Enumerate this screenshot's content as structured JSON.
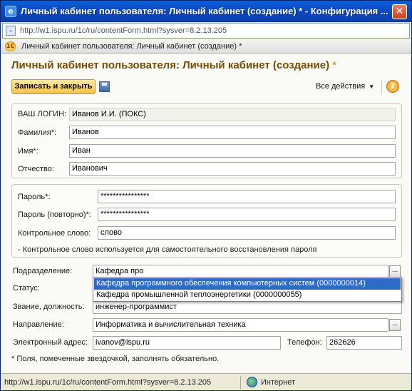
{
  "window": {
    "title": "Личный кабинет пользователя: Личный кабинет (создание) * - Конфигурация ...",
    "close_glyph": "✕"
  },
  "address": {
    "url": "http://w1.ispu.ru/1c/ru/contentForm.html?sysver=8.2.13.205"
  },
  "tab": {
    "label": "Личный кабинет пользователя: Личный кабинет (создание) *",
    "app_icon_text": "1С"
  },
  "form": {
    "title": "Личный кабинет пользователя: Личный кабинет (создание)",
    "modified_mark": "*",
    "save_close_label": "Записать и закрыть",
    "all_actions_label": "Все действия",
    "help_glyph": "?"
  },
  "personal": {
    "login_label": "ВАШ ЛОГИН:",
    "login_value": "Иванов И.И. (ПОКС)",
    "lastname_label": "Фамилия*:",
    "lastname_value": "Иванов",
    "firstname_label": "Имя*:",
    "firstname_value": "Иван",
    "patronymic_label": "Отчество:",
    "patronymic_value": "Иванович"
  },
  "security": {
    "password_label": "Пароль*:",
    "password_value": "****************",
    "password_repeat_label": "Пароль (повторно)*:",
    "password_repeat_value": "****************",
    "control_word_label": "Контрольное слово:",
    "control_word_value": "слово",
    "note": "- Контрольное слово используется для самостоятельного восстановления пароля"
  },
  "details": {
    "department_label": "Подразделение:",
    "department_value": "Кафедра про",
    "status_label": "Статус:",
    "position_label": "Звание, должность:",
    "position_value": "инженер-программист",
    "direction_label": "Направление:",
    "direction_value": "Информатика и вычислительная техника",
    "email_label": "Электронный адрес:",
    "email_value": "ivanov@ispu.ru",
    "phone_label": "Телефон:",
    "phone_value": "262626",
    "footnote": "* Поля, помеченные звездочкой, заполнять обязательно.",
    "pick_glyph": "..."
  },
  "dropdown": {
    "options": [
      "Кафедра программного обеспечения компьютерных систем (0000000014)",
      "Кафедра промышленной теплоэнергетики (0000000055)"
    ],
    "selected_index": 0
  },
  "statusbar": {
    "url": "http://w1.ispu.ru/1c/ru/contentForm.html?sysver=8.2.13.205",
    "zone": "Интернет"
  }
}
